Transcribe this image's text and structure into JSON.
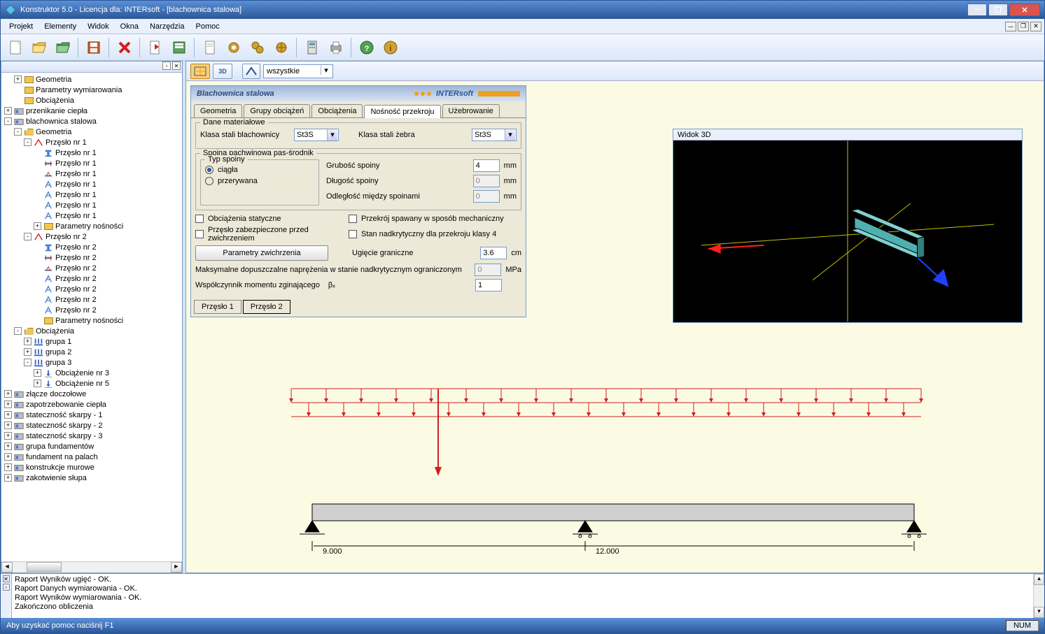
{
  "titlebar": "Konstruktor 5.0 - Licencja dla: INTERsoft - [blachownica stalowa]",
  "menu": [
    "Projekt",
    "Elementy",
    "Widok",
    "Okna",
    "Narzędzia",
    "Pomoc"
  ],
  "toolbar_icons": [
    "new",
    "open",
    "open-project",
    "save",
    "delete",
    "export",
    "calc",
    "page",
    "gear1",
    "gear2",
    "gear3",
    "calculator",
    "print",
    "help",
    "info"
  ],
  "canvas_toolbar": {
    "view2d": "2D",
    "view3d": "3D",
    "scope": "wszystkie"
  },
  "tree": [
    {
      "d": 1,
      "exp": "+",
      "ico": "folder",
      "lbl": "Geometria"
    },
    {
      "d": 1,
      "exp": "",
      "ico": "folder",
      "lbl": "Parametry wymiarowania"
    },
    {
      "d": 1,
      "exp": "",
      "ico": "folder",
      "lbl": "Obciążenia"
    },
    {
      "d": 0,
      "exp": "+",
      "ico": "mod",
      "lbl": "przenikanie ciepła"
    },
    {
      "d": 0,
      "exp": "-",
      "ico": "mod",
      "lbl": "blachownica stalowa"
    },
    {
      "d": 1,
      "exp": "-",
      "ico": "folder-open",
      "lbl": "Geometria"
    },
    {
      "d": 2,
      "exp": "-",
      "ico": "span",
      "lbl": "Przęsło nr 1"
    },
    {
      "d": 3,
      "exp": "",
      "ico": "sec1",
      "lbl": "Przęsło nr 1"
    },
    {
      "d": 3,
      "exp": "",
      "ico": "sec2",
      "lbl": "Przęsło nr 1"
    },
    {
      "d": 3,
      "exp": "",
      "ico": "sec3",
      "lbl": "Przęsło nr 1"
    },
    {
      "d": 3,
      "exp": "",
      "ico": "secA",
      "lbl": "Przęsło nr 1"
    },
    {
      "d": 3,
      "exp": "",
      "ico": "secA",
      "lbl": "Przęsło nr 1"
    },
    {
      "d": 3,
      "exp": "",
      "ico": "secA",
      "lbl": "Przęsło nr 1"
    },
    {
      "d": 3,
      "exp": "",
      "ico": "secA",
      "lbl": "Przęsło nr 1"
    },
    {
      "d": 3,
      "exp": "+",
      "ico": "folder",
      "lbl": "Parametry nośności"
    },
    {
      "d": 2,
      "exp": "-",
      "ico": "span",
      "lbl": "Przęsło nr 2"
    },
    {
      "d": 3,
      "exp": "",
      "ico": "sec1",
      "lbl": "Przęsło nr 2"
    },
    {
      "d": 3,
      "exp": "",
      "ico": "sec2",
      "lbl": "Przęsło nr 2"
    },
    {
      "d": 3,
      "exp": "",
      "ico": "sec3",
      "lbl": "Przęsło nr 2"
    },
    {
      "d": 3,
      "exp": "",
      "ico": "secA",
      "lbl": "Przęsło nr 2"
    },
    {
      "d": 3,
      "exp": "",
      "ico": "secA",
      "lbl": "Przęsło nr 2"
    },
    {
      "d": 3,
      "exp": "",
      "ico": "secA",
      "lbl": "Przęsło nr 2"
    },
    {
      "d": 3,
      "exp": "",
      "ico": "secA",
      "lbl": "Przęsło nr 2"
    },
    {
      "d": 3,
      "exp": "",
      "ico": "folder",
      "lbl": "Parametry nośności"
    },
    {
      "d": 1,
      "exp": "-",
      "ico": "folder-open",
      "lbl": "Obciążenia"
    },
    {
      "d": 2,
      "exp": "+",
      "ico": "load",
      "lbl": "grupa 1"
    },
    {
      "d": 2,
      "exp": "+",
      "ico": "load",
      "lbl": "grupa 2"
    },
    {
      "d": 2,
      "exp": "-",
      "ico": "load",
      "lbl": "grupa 3"
    },
    {
      "d": 3,
      "exp": "+",
      "ico": "lc",
      "lbl": "Obciążenie nr 3"
    },
    {
      "d": 3,
      "exp": "+",
      "ico": "lc",
      "lbl": "Obciążenie nr 5"
    },
    {
      "d": 0,
      "exp": "+",
      "ico": "mod",
      "lbl": "złącze doczołowe"
    },
    {
      "d": 0,
      "exp": "+",
      "ico": "mod",
      "lbl": "zapotrzebowanie ciepła"
    },
    {
      "d": 0,
      "exp": "+",
      "ico": "mod",
      "lbl": "stateczność skarpy - 1"
    },
    {
      "d": 0,
      "exp": "+",
      "ico": "mod",
      "lbl": "stateczność skarpy - 2"
    },
    {
      "d": 0,
      "exp": "+",
      "ico": "mod",
      "lbl": "stateczność skarpy - 3"
    },
    {
      "d": 0,
      "exp": "+",
      "ico": "mod",
      "lbl": "grupa fundamentów"
    },
    {
      "d": 0,
      "exp": "+",
      "ico": "mod",
      "lbl": "fundament na palach"
    },
    {
      "d": 0,
      "exp": "+",
      "ico": "mod",
      "lbl": "konstrukcje murowe"
    },
    {
      "d": 0,
      "exp": "+",
      "ico": "mod",
      "lbl": "zakotwienie słupa"
    }
  ],
  "dialog": {
    "title": "Blachownica stalowa",
    "brand": "INTERsoft",
    "tabs": [
      "Geometria",
      "Grupy obciążeń",
      "Obciążenia",
      "Nośność przekroju",
      "Użebrowanie"
    ],
    "active_tab": 3,
    "g_material": {
      "title": "Dane materiałowe",
      "steel_plate_lbl": "Klasa stali blachownicy",
      "steel_plate_val": "St3S",
      "steel_rib_lbl": "Klasa stali żebra",
      "steel_rib_val": "St3S"
    },
    "g_weld": {
      "title": "Spoina pachwinowa pas-środnik",
      "type_title": "Typ spoiny",
      "opt_cont": "ciągła",
      "opt_int": "przerywana",
      "thick_lbl": "Grubość spoiny",
      "thick_val": "4",
      "thick_u": "mm",
      "len_lbl": "Długość spoiny",
      "len_val": "0",
      "len_u": "mm",
      "dist_lbl": "Odległość między spoinami",
      "dist_val": "0",
      "dist_u": "mm"
    },
    "chk_static": "Obciążenia statyczne",
    "chk_mech": "Przekrój spawany w sposób mechaniczny",
    "chk_prot": "Przęsło zabezpieczone przed zwichrzeniem",
    "chk_super": "Stan nadkrytyczny dla przekroju klasy 4",
    "btn_ltb": "Parametry zwichrzenia",
    "defl_lbl": "Ugięcie graniczne",
    "defl_val": "3.6",
    "defl_u": "cm",
    "stress_lbl": "Maksymalne dopuszczalne naprężenia w stanie nadkrytycznym ograniczonym",
    "stress_val": "0",
    "stress_u": "MPa",
    "beta_lbl": "Współczynnik momentu zginającego",
    "beta_sym": "βₓ",
    "beta_val": "1",
    "bottom_tabs": [
      "Przęsło 1",
      "Przęsło 2"
    ]
  },
  "view3d_title": "Widok 3D",
  "beam": {
    "span1": "9.000",
    "span2": "12.000"
  },
  "output": [
    "Raport Wyników ugięć - OK.",
    "Raport Danych wymiarowania - OK.",
    "Raport Wyników wymiarowania - OK.",
    "Zakończono obliczenia"
  ],
  "status": "Aby uzyskać pomoc naciśnij F1",
  "status_num": "NUM"
}
